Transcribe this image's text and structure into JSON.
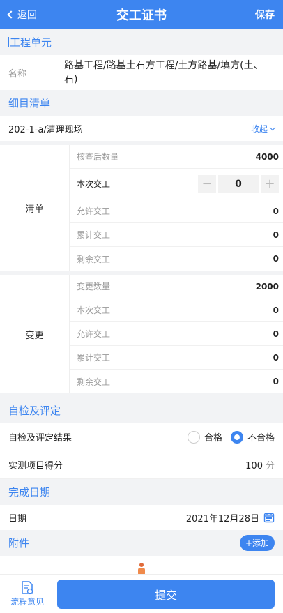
{
  "header": {
    "back": "返回",
    "title": "交工证书",
    "save": "保存"
  },
  "project_unit": {
    "section": "工程单元",
    "name_label": "名称",
    "name_value": "路基工程/路基土石方工程/土方路基/填方(土、石)"
  },
  "detail": {
    "section": "细目清单",
    "item": "202-1-a/清理现场",
    "collapse": "收起"
  },
  "list_group": {
    "label": "清单",
    "rows": [
      {
        "label": "核查后数量",
        "value": "4000"
      },
      {
        "label": "本次交工",
        "value": "0"
      },
      {
        "label": "允许交工",
        "value": "0"
      },
      {
        "label": "累计交工",
        "value": "0"
      },
      {
        "label": "剩余交工",
        "value": "0"
      }
    ],
    "stepper_minus": "−",
    "stepper_plus": "+"
  },
  "change_group": {
    "label": "变更",
    "rows": [
      {
        "label": "变更数量",
        "value": "2000"
      },
      {
        "label": "本次交工",
        "value": "0"
      },
      {
        "label": "允许交工",
        "value": "0"
      },
      {
        "label": "累计交工",
        "value": "0"
      },
      {
        "label": "剩余交工",
        "value": "0"
      }
    ]
  },
  "inspection": {
    "section": "自检及评定",
    "result_label": "自检及评定结果",
    "options": [
      "合格",
      "不合格"
    ],
    "selected": "不合格",
    "score_label": "实测项目得分",
    "score_value": "100",
    "score_unit": "分"
  },
  "completion": {
    "section": "完成日期",
    "date_label": "日期",
    "date_value": "2021年12月28日"
  },
  "attachment": {
    "section": "附件",
    "add": "+添加"
  },
  "footer": {
    "flow": "流程意见",
    "submit": "提交"
  },
  "colors": {
    "accent": "#3d85f0",
    "background": "#f2f3f5"
  }
}
